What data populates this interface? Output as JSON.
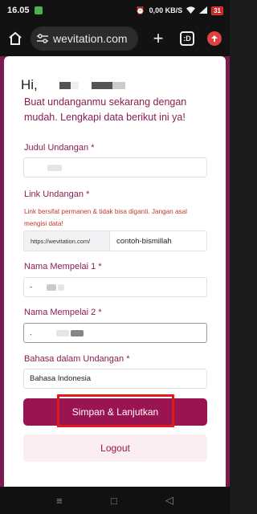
{
  "status": {
    "time": "16.05",
    "network": "0,00 KB/S",
    "battery": "31"
  },
  "browser": {
    "url": "wevitation.com",
    "tabs_count": ":D"
  },
  "page": {
    "greeting": "Hi, ",
    "subtitle": "Buat undanganmu sekarang dengan mudah. Lengkapi data berikut ini ya!",
    "fields": {
      "judul": {
        "label": "Judul Undangan",
        "required": "*",
        "value": ""
      },
      "link": {
        "label": "Link Undangan",
        "required": "*",
        "helper": "Link bersifat permanen & tidak bisa diganti. Jangan asal mengisi data!",
        "prefix": "https://wevitation.com/",
        "value": "contoh-bismillah"
      },
      "mempelai1": {
        "label": "Nama Mempelai 1",
        "required": "*",
        "value": "-"
      },
      "mempelai2": {
        "label": "Nama Mempelai 2",
        "required": "*",
        "value": "."
      },
      "bahasa": {
        "label": "Bahasa dalam Undangan",
        "required": "*",
        "value": "Bahasa Indonesia"
      }
    },
    "submit_label": "Simpan & Lanjutkan",
    "logout_label": "Logout"
  },
  "colors": {
    "brand": "#9b1452",
    "label": "#8a1d52",
    "helper": "#c0392b",
    "highlight": "#e01b1b"
  },
  "nav": {
    "recent": "≡",
    "home": "□",
    "back": "◁"
  }
}
